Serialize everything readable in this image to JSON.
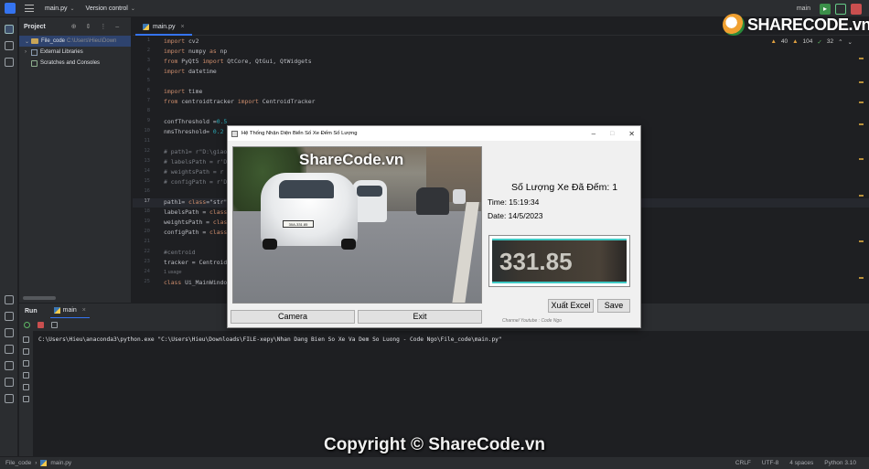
{
  "titlebar": {
    "project": "main.py",
    "vcs": "Version control",
    "branch": "main"
  },
  "logo": {
    "text": "SHARECODE.vn"
  },
  "project_panel": {
    "title": "Project",
    "items": [
      {
        "label": "File_code",
        "path": "C:\\Users\\Hieu\\Down"
      },
      {
        "label": "External Libraries"
      },
      {
        "label": "Scratches and Consoles"
      }
    ]
  },
  "editor": {
    "tab": "main.py",
    "inspections": {
      "warnings": "40",
      "weak": "104",
      "ok": "32"
    },
    "lines": [
      {
        "n": "1",
        "t": "import cv2"
      },
      {
        "n": "2",
        "t": "import numpy as np"
      },
      {
        "n": "3",
        "t": "from PyQt5 import QtCore, QtGui, QtWidgets"
      },
      {
        "n": "4",
        "t": "import datetime"
      },
      {
        "n": "5",
        "t": ""
      },
      {
        "n": "6",
        "t": "import time"
      },
      {
        "n": "7",
        "t": "from centroidtracker import CentroidTracker"
      },
      {
        "n": "8",
        "t": ""
      },
      {
        "n": "9",
        "t": "confThreshold =0.5"
      },
      {
        "n": "10",
        "t": "nmsThreshold= 0.2"
      },
      {
        "n": "11",
        "t": ""
      },
      {
        "n": "12",
        "t": "# path1= r\"D:\\giao"
      },
      {
        "n": "13",
        "t": "# labelsPath = r'D"
      },
      {
        "n": "14",
        "t": "# weightsPath = r"
      },
      {
        "n": "15",
        "t": "# configPath = r'D"
      },
      {
        "n": "16",
        "t": ""
      },
      {
        "n": "17",
        "t": "path1= \"testbienso"
      },
      {
        "n": "18",
        "t": "labelsPath = 'yolo"
      },
      {
        "n": "19",
        "t": "weightsPath = 'yol"
      },
      {
        "n": "20",
        "t": "configPath = 'yolo"
      },
      {
        "n": "21",
        "t": ""
      },
      {
        "n": "22",
        "t": "#centroid"
      },
      {
        "n": "23",
        "t": "tracker = Centroid"
      },
      {
        "n": "24",
        "t": ""
      },
      {
        "n": "25",
        "t": "class Ui_MainWindo"
      }
    ],
    "usage_hint": "1 usage"
  },
  "run": {
    "label": "Run",
    "tab": "main",
    "command": "C:\\Users\\Hieu\\anaconda3\\python.exe \"C:\\Users\\Hieu\\Downloads\\FILE-xepy\\Nhan Dang Bien So Xe Va Dem So Luong - Code Ngo\\File_code\\main.py\""
  },
  "statusbar": {
    "crumb1": "File_code",
    "crumb2": "main.py",
    "line_sep": "CRLF",
    "encoding": "UTF-8",
    "indent": "4 spaces",
    "interpreter": "Python 3.10"
  },
  "copyright": "Copyright © ShareCode.vn",
  "qt_window": {
    "title": "Hệ Thống Nhận Diện Biển Số Xe Đếm Số Lượng",
    "watermark": "ShareCode.vn",
    "car_plate_small": "30A-331.85",
    "count_label": "Số Lượng Xe Đã Đếm: 1",
    "time_label": "Time: 15:19:34",
    "date_label": "Date: 14/5/2023",
    "plate_text": "331.85",
    "camera_button": "Camera",
    "exit_button": "Exit",
    "excel_button": "Xuất Excel",
    "save_button": "Save",
    "channel": "Channel Youtube : Code Ngo"
  }
}
